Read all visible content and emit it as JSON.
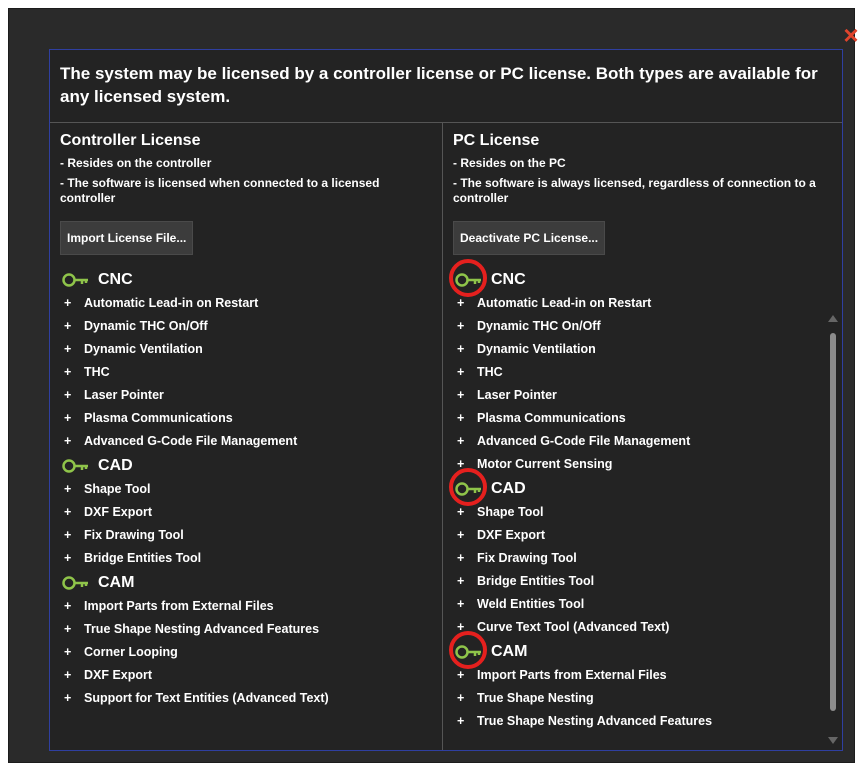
{
  "close_label": "×",
  "header_text": "The system may be licensed by a controller license or PC license.  Both types are available for any licensed system.",
  "left": {
    "title": "Controller License",
    "desc1": "- Resides on the controller",
    "desc2": "- The software is licensed when connected to a licensed controller",
    "button": "Import License File...",
    "cnc_title": "CNC",
    "cnc_items": [
      "Automatic Lead-in on Restart",
      "Dynamic THC On/Off",
      "Dynamic Ventilation",
      "THC",
      "Laser Pointer",
      "Plasma Communications",
      "Advanced G-Code File Management"
    ],
    "cad_title": "CAD",
    "cad_items": [
      "Shape Tool",
      "DXF Export",
      "Fix Drawing Tool",
      "Bridge Entities Tool"
    ],
    "cam_title": "CAM",
    "cam_items": [
      "Import Parts from External Files",
      "True Shape Nesting Advanced Features",
      "Corner Looping",
      "DXF Export",
      "Support for Text Entities (Advanced Text)"
    ]
  },
  "right": {
    "title": "PC License",
    "desc1": "- Resides on the PC",
    "desc2": "- The software is always licensed, regardless of connection to a controller",
    "button": "Deactivate PC License...",
    "cnc_title": "CNC",
    "cnc_items": [
      "Automatic Lead-in on Restart",
      "Dynamic THC On/Off",
      "Dynamic Ventilation",
      "THC",
      "Laser Pointer",
      "Plasma Communications",
      "Advanced G-Code File Management",
      "Motor Current Sensing"
    ],
    "cad_title": "CAD",
    "cad_items": [
      "Shape Tool",
      "DXF Export",
      "Fix Drawing Tool",
      "Bridge Entities Tool",
      "Weld Entities Tool",
      "Curve Text Tool (Advanced Text)"
    ],
    "cam_title": "CAM",
    "cam_items": [
      "Import Parts from External Files",
      "True Shape Nesting",
      "True Shape Nesting Advanced Features"
    ]
  },
  "plus": "+",
  "colors": {
    "accent_key": "#8fc44a",
    "highlight": "#e5201e",
    "frame_border": "#2f3fa0",
    "close": "#e0442c"
  }
}
